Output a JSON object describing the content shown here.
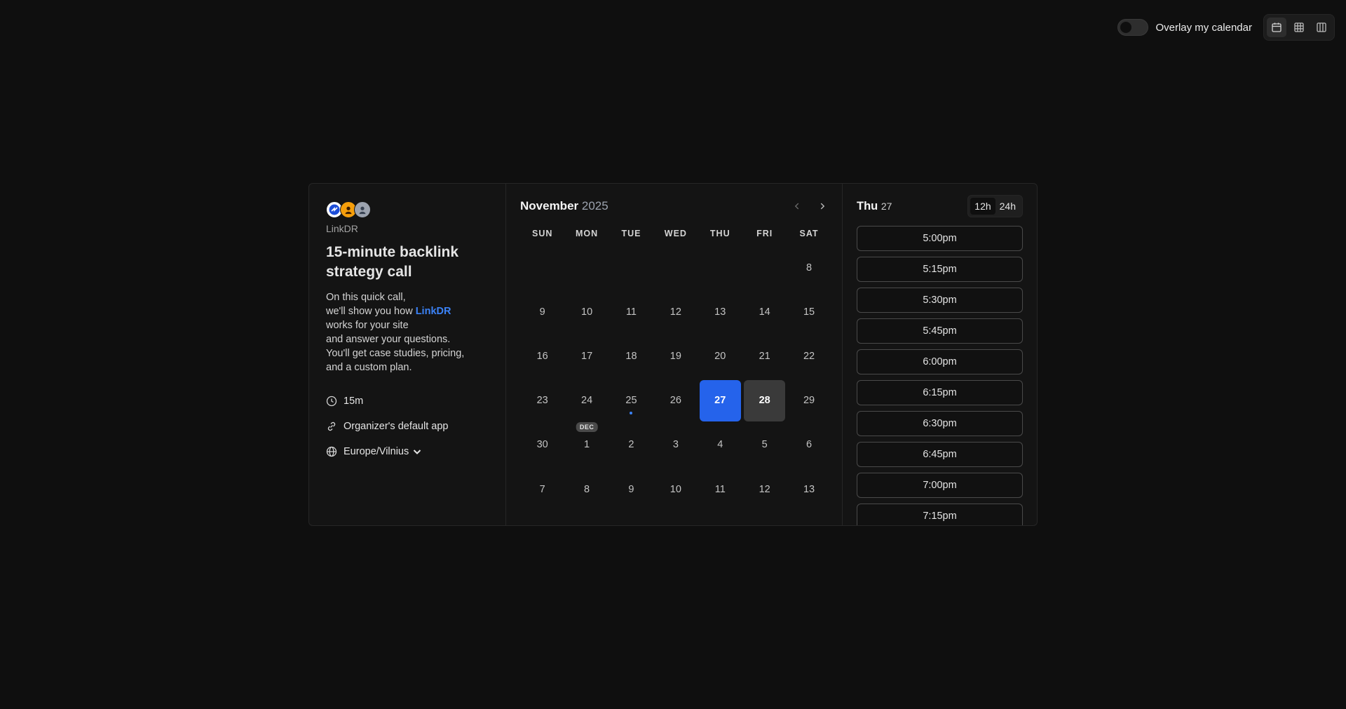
{
  "topbar": {
    "overlay_label": "Overlay my calendar",
    "view_buttons": [
      "calendar-view-icon",
      "grid-view-icon",
      "column-view-icon"
    ]
  },
  "event": {
    "organizer": "LinkDR",
    "title": "15-minute backlink strategy call",
    "description_lines": [
      "On this quick call,",
      "we'll show you how",
      "LinkDR",
      "works for your site",
      "and answer your questions.",
      "You'll get case studies, pricing,",
      "and a custom plan."
    ],
    "duration": "15m",
    "location": "Organizer's default app",
    "timezone": "Europe/Vilnius"
  },
  "calendar": {
    "month": "November",
    "year": "2025",
    "weekdays": [
      "SUN",
      "MON",
      "TUE",
      "WED",
      "THU",
      "FRI",
      "SAT"
    ],
    "weeks": [
      [
        "",
        "",
        "",
        "",
        "",
        "",
        "8"
      ],
      [
        "9",
        "10",
        "11",
        "12",
        "13",
        "14",
        "15"
      ],
      [
        "16",
        "17",
        "18",
        "19",
        "20",
        "21",
        "22"
      ],
      [
        "23",
        "24",
        "25",
        "26",
        "27",
        "28",
        "29"
      ],
      [
        "30",
        "1",
        "2",
        "3",
        "4",
        "5",
        "6"
      ],
      [
        "7",
        "8",
        "9",
        "10",
        "11",
        "12",
        "13"
      ]
    ],
    "selected_day": "27",
    "available_day": "28",
    "today_dot_day": "25",
    "next_month_badge": "DEC",
    "colors": {
      "selected": "#2563eb",
      "available": "#3a3a3a",
      "dot": "#3b82f6"
    }
  },
  "slots": {
    "day_name": "Thu",
    "day_number": "27",
    "format_12h": "12h",
    "format_24h": "24h",
    "active_format": "12h",
    "times": [
      "5:00pm",
      "5:15pm",
      "5:30pm",
      "5:45pm",
      "6:00pm",
      "6:15pm",
      "6:30pm",
      "6:45pm",
      "7:00pm",
      "7:15pm"
    ]
  }
}
